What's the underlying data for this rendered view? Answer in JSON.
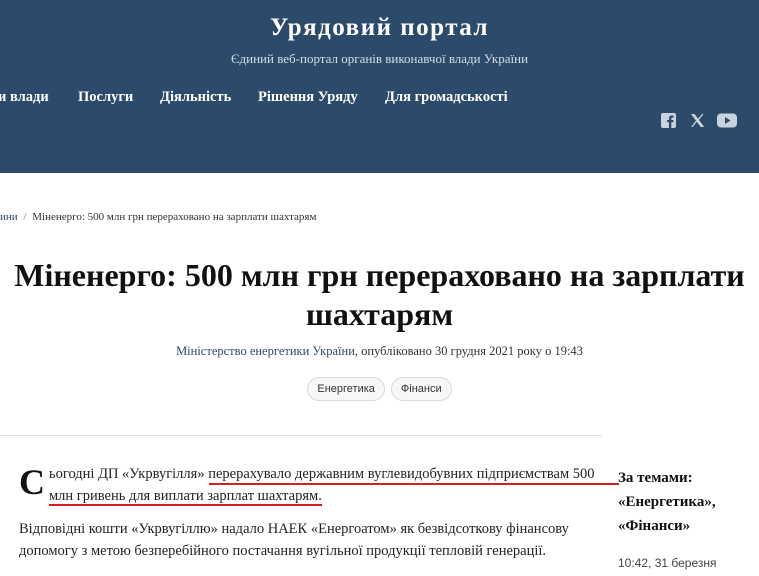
{
  "header": {
    "title": "Урядовий портал",
    "subtitle": "Єдиний веб-портал органів виконавчої влади України",
    "nav": [
      "и влади",
      "Послуги",
      "Діяльність",
      "Рішення Уряду",
      "Для громадськості"
    ],
    "social": [
      "facebook-icon",
      "x-icon",
      "youtube-icon"
    ]
  },
  "breadcrumb": {
    "parent": "ини",
    "separator": "/",
    "current": "Міненерго: 500 млн грн перераховано на зарплати шахтарям"
  },
  "article": {
    "headline_line1": "Міненерго: 500 млн грн перераховано на зарплати",
    "headline_line2": "шахтарям",
    "author": "Міністерство енергетики України",
    "published": ", опубліковано 30 грудня 2021 року о 19:43",
    "tags": [
      "Енергетика",
      "Фінанси"
    ],
    "dropcap": "С",
    "lead_a": "ьогодні ДП «Укрвугілля» ",
    "lead_b": "перерахувало державним вуглевидобувних підприємствам 500",
    "lead_c": "млн гривень для виплати зарплат шахтарям.",
    "para2": "Відповідні кошти «Укрвугіллю» надало НАЕК «Енергоатом» як безвідсоткову фінансову допомогу з метою безперебійного постачання вугільної продукції тепловій генерації."
  },
  "aside": {
    "heading_line1": "За темами:",
    "heading_line2": "«Енергетика»,",
    "heading_line3": "«Фінанси»",
    "time": "10:42, 31 березня"
  },
  "colors": {
    "header_bg": "#2c4a69",
    "highlight": "#d21f2a",
    "link": "#2c4a69"
  }
}
